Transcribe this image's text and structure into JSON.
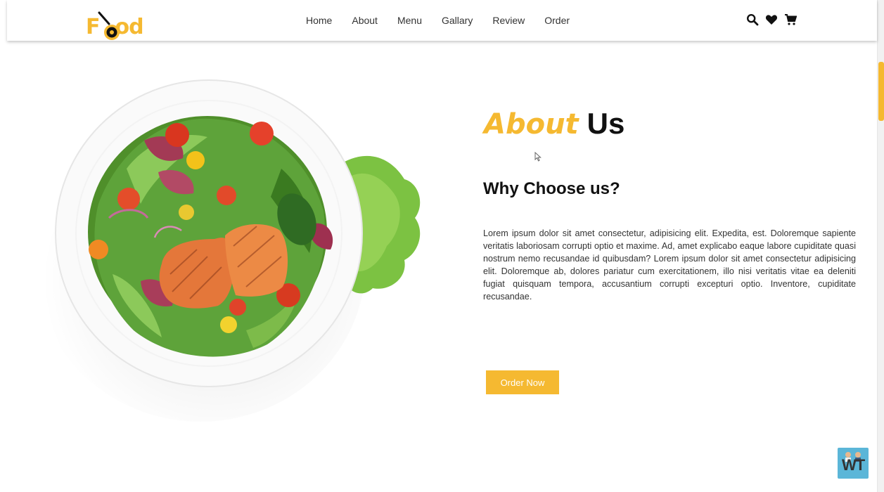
{
  "brand": {
    "logo_text_start": "F",
    "logo_text_end": "od",
    "accent_color": "#f5b931"
  },
  "nav": {
    "items": [
      {
        "label": "Home"
      },
      {
        "label": "About"
      },
      {
        "label": "Menu"
      },
      {
        "label": "Gallary"
      },
      {
        "label": "Review"
      },
      {
        "label": "Order"
      }
    ]
  },
  "header_icons": [
    "search-icon",
    "heart-icon",
    "cart-icon"
  ],
  "about": {
    "title_accent": "About",
    "title_rest": "Us",
    "subtitle": "Why Choose us?",
    "paragraph": "Lorem ipsum dolor sit amet consectetur, adipisicing elit. Expedita, est. Doloremque sapiente veritatis laboriosam corrupti optio et maxime. Ad, amet explicabo eaque labore cupiditate quasi nostrum nemo recusandae id quibusdam? Lorem ipsum dolor sit amet consectetur adipisicing elit. Doloremque ab, dolores pariatur cum exercitationem, illo nisi veritatis vitae ea deleniti fugiat quisquam tempora, accusantium corrupti excepturi optio. Inventore, cupiditate recusandae.",
    "button_label": "Order Now"
  },
  "badge": {
    "text": "WT"
  }
}
